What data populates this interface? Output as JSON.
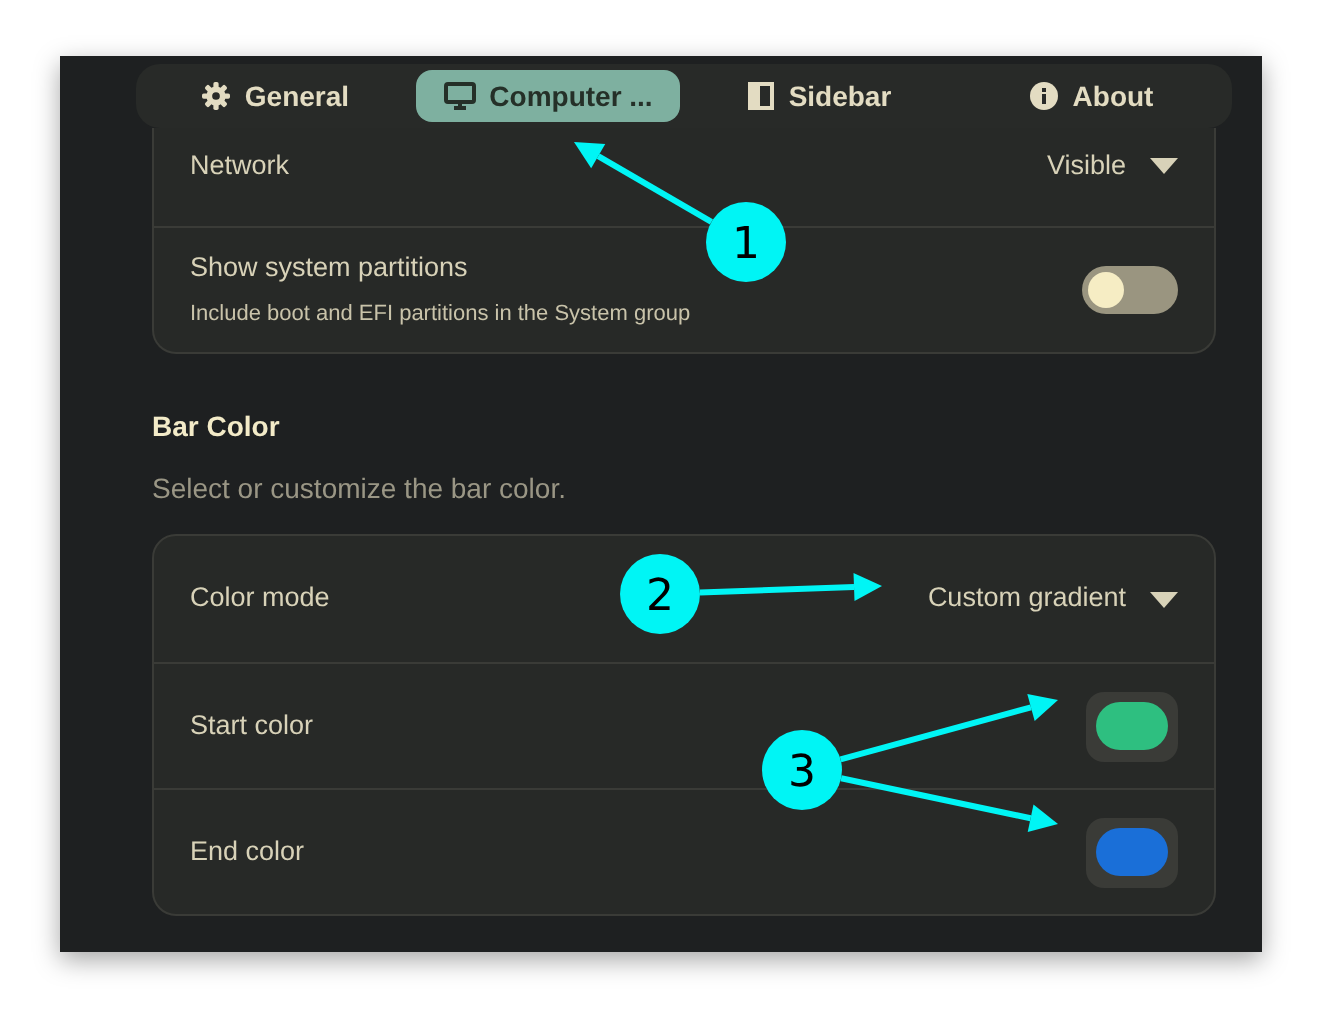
{
  "tabs": [
    {
      "label": "General",
      "selected": false
    },
    {
      "label": "Computer ...",
      "selected": true
    },
    {
      "label": "Sidebar",
      "selected": false
    },
    {
      "label": "About",
      "selected": false
    }
  ],
  "top_group": {
    "rows": [
      {
        "kind": "dropdown",
        "label": "Network",
        "value": "Visible"
      },
      {
        "kind": "switch",
        "label": "Show system partitions",
        "description": "Include boot and EFI partitions in the System group",
        "on": false
      }
    ]
  },
  "bar_color": {
    "title": "Bar Color",
    "subtitle": "Select or customize the bar color.",
    "rows": [
      {
        "kind": "dropdown",
        "label": "Color mode",
        "value": "Custom gradient"
      },
      {
        "kind": "color",
        "label": "Start color",
        "color": "#2ebf80"
      },
      {
        "kind": "color",
        "label": "End color",
        "color": "#1a6fd8"
      }
    ]
  },
  "annotations": [
    {
      "label": "1"
    },
    {
      "label": "2"
    },
    {
      "label": "3"
    }
  ]
}
